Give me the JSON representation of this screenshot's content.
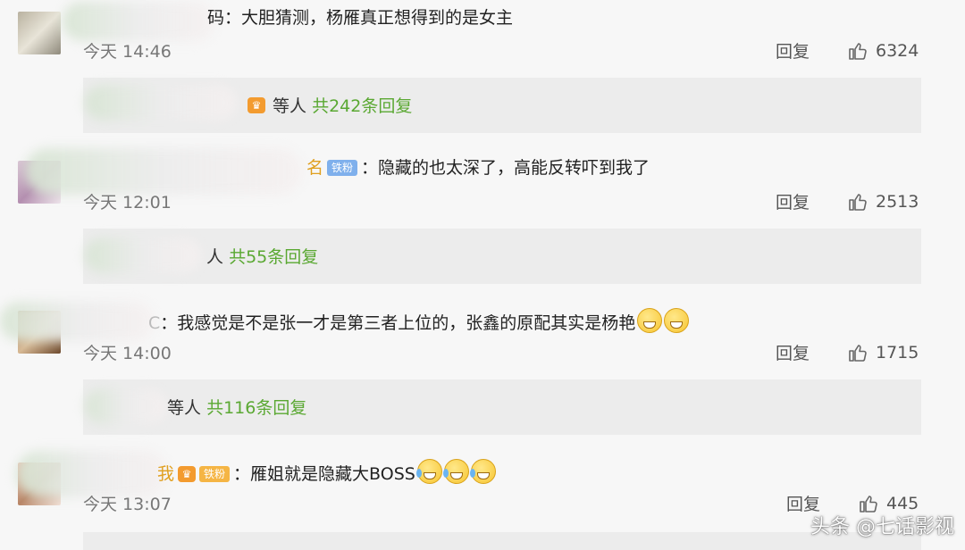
{
  "comments": [
    {
      "name_suffix": "码",
      "text": "：大胆猜测，杨雁真正想得到的是女主",
      "time": "今天 14:46",
      "reply_label": "回复",
      "likes": "6324",
      "replies": {
        "prefix": "等人",
        "count": "共242条回复"
      }
    },
    {
      "name_suffix": "名",
      "badge": "铁粉",
      "text": "：隐藏的也太深了，高能反转吓到我了",
      "time": "今天 12:01",
      "reply_label": "回复",
      "likes": "2513",
      "replies": {
        "prefix": "人",
        "count": "共55条回复"
      }
    },
    {
      "name_suffix": "C",
      "text": "：我感觉是不是张一才是第三者上位的，张鑫的原配其实是杨艳",
      "time": "今天 14:00",
      "reply_label": "回复",
      "likes": "1715",
      "replies": {
        "prefix": "等人",
        "count": "共116条回复"
      }
    },
    {
      "name_suffix": "我",
      "badge": "铁粉",
      "text": "：雁姐就是隐藏大BOSS",
      "time": "今天 13:07",
      "reply_label": "回复",
      "likes": "445"
    }
  ],
  "watermark": "头条 @七话影视",
  "colors": {
    "reply_count": "#5aa832",
    "badge_blue": "#7fb0ec",
    "badge_orange": "#f5b544"
  }
}
